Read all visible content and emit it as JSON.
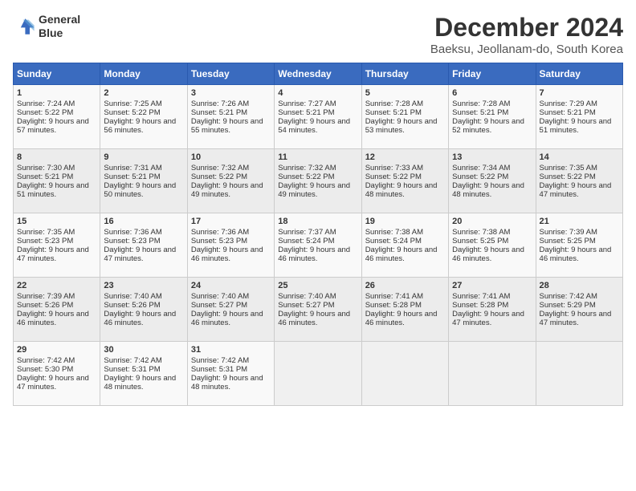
{
  "logo": {
    "line1": "General",
    "line2": "Blue"
  },
  "title": "December 2024",
  "subtitle": "Baeksu, Jeollanam-do, South Korea",
  "days_of_week": [
    "Sunday",
    "Monday",
    "Tuesday",
    "Wednesday",
    "Thursday",
    "Friday",
    "Saturday"
  ],
  "weeks": [
    [
      {
        "day": "1",
        "sunrise": "Sunrise: 7:24 AM",
        "sunset": "Sunset: 5:22 PM",
        "daylight": "Daylight: 9 hours and 57 minutes."
      },
      {
        "day": "2",
        "sunrise": "Sunrise: 7:25 AM",
        "sunset": "Sunset: 5:22 PM",
        "daylight": "Daylight: 9 hours and 56 minutes."
      },
      {
        "day": "3",
        "sunrise": "Sunrise: 7:26 AM",
        "sunset": "Sunset: 5:21 PM",
        "daylight": "Daylight: 9 hours and 55 minutes."
      },
      {
        "day": "4",
        "sunrise": "Sunrise: 7:27 AM",
        "sunset": "Sunset: 5:21 PM",
        "daylight": "Daylight: 9 hours and 54 minutes."
      },
      {
        "day": "5",
        "sunrise": "Sunrise: 7:28 AM",
        "sunset": "Sunset: 5:21 PM",
        "daylight": "Daylight: 9 hours and 53 minutes."
      },
      {
        "day": "6",
        "sunrise": "Sunrise: 7:28 AM",
        "sunset": "Sunset: 5:21 PM",
        "daylight": "Daylight: 9 hours and 52 minutes."
      },
      {
        "day": "7",
        "sunrise": "Sunrise: 7:29 AM",
        "sunset": "Sunset: 5:21 PM",
        "daylight": "Daylight: 9 hours and 51 minutes."
      }
    ],
    [
      {
        "day": "8",
        "sunrise": "Sunrise: 7:30 AM",
        "sunset": "Sunset: 5:21 PM",
        "daylight": "Daylight: 9 hours and 51 minutes."
      },
      {
        "day": "9",
        "sunrise": "Sunrise: 7:31 AM",
        "sunset": "Sunset: 5:21 PM",
        "daylight": "Daylight: 9 hours and 50 minutes."
      },
      {
        "day": "10",
        "sunrise": "Sunrise: 7:32 AM",
        "sunset": "Sunset: 5:22 PM",
        "daylight": "Daylight: 9 hours and 49 minutes."
      },
      {
        "day": "11",
        "sunrise": "Sunrise: 7:32 AM",
        "sunset": "Sunset: 5:22 PM",
        "daylight": "Daylight: 9 hours and 49 minutes."
      },
      {
        "day": "12",
        "sunrise": "Sunrise: 7:33 AM",
        "sunset": "Sunset: 5:22 PM",
        "daylight": "Daylight: 9 hours and 48 minutes."
      },
      {
        "day": "13",
        "sunrise": "Sunrise: 7:34 AM",
        "sunset": "Sunset: 5:22 PM",
        "daylight": "Daylight: 9 hours and 48 minutes."
      },
      {
        "day": "14",
        "sunrise": "Sunrise: 7:35 AM",
        "sunset": "Sunset: 5:22 PM",
        "daylight": "Daylight: 9 hours and 47 minutes."
      }
    ],
    [
      {
        "day": "15",
        "sunrise": "Sunrise: 7:35 AM",
        "sunset": "Sunset: 5:23 PM",
        "daylight": "Daylight: 9 hours and 47 minutes."
      },
      {
        "day": "16",
        "sunrise": "Sunrise: 7:36 AM",
        "sunset": "Sunset: 5:23 PM",
        "daylight": "Daylight: 9 hours and 47 minutes."
      },
      {
        "day": "17",
        "sunrise": "Sunrise: 7:36 AM",
        "sunset": "Sunset: 5:23 PM",
        "daylight": "Daylight: 9 hours and 46 minutes."
      },
      {
        "day": "18",
        "sunrise": "Sunrise: 7:37 AM",
        "sunset": "Sunset: 5:24 PM",
        "daylight": "Daylight: 9 hours and 46 minutes."
      },
      {
        "day": "19",
        "sunrise": "Sunrise: 7:38 AM",
        "sunset": "Sunset: 5:24 PM",
        "daylight": "Daylight: 9 hours and 46 minutes."
      },
      {
        "day": "20",
        "sunrise": "Sunrise: 7:38 AM",
        "sunset": "Sunset: 5:25 PM",
        "daylight": "Daylight: 9 hours and 46 minutes."
      },
      {
        "day": "21",
        "sunrise": "Sunrise: 7:39 AM",
        "sunset": "Sunset: 5:25 PM",
        "daylight": "Daylight: 9 hours and 46 minutes."
      }
    ],
    [
      {
        "day": "22",
        "sunrise": "Sunrise: 7:39 AM",
        "sunset": "Sunset: 5:26 PM",
        "daylight": "Daylight: 9 hours and 46 minutes."
      },
      {
        "day": "23",
        "sunrise": "Sunrise: 7:40 AM",
        "sunset": "Sunset: 5:26 PM",
        "daylight": "Daylight: 9 hours and 46 minutes."
      },
      {
        "day": "24",
        "sunrise": "Sunrise: 7:40 AM",
        "sunset": "Sunset: 5:27 PM",
        "daylight": "Daylight: 9 hours and 46 minutes."
      },
      {
        "day": "25",
        "sunrise": "Sunrise: 7:40 AM",
        "sunset": "Sunset: 5:27 PM",
        "daylight": "Daylight: 9 hours and 46 minutes."
      },
      {
        "day": "26",
        "sunrise": "Sunrise: 7:41 AM",
        "sunset": "Sunset: 5:28 PM",
        "daylight": "Daylight: 9 hours and 46 minutes."
      },
      {
        "day": "27",
        "sunrise": "Sunrise: 7:41 AM",
        "sunset": "Sunset: 5:28 PM",
        "daylight": "Daylight: 9 hours and 47 minutes."
      },
      {
        "day": "28",
        "sunrise": "Sunrise: 7:42 AM",
        "sunset": "Sunset: 5:29 PM",
        "daylight": "Daylight: 9 hours and 47 minutes."
      }
    ],
    [
      {
        "day": "29",
        "sunrise": "Sunrise: 7:42 AM",
        "sunset": "Sunset: 5:30 PM",
        "daylight": "Daylight: 9 hours and 47 minutes."
      },
      {
        "day": "30",
        "sunrise": "Sunrise: 7:42 AM",
        "sunset": "Sunset: 5:31 PM",
        "daylight": "Daylight: 9 hours and 48 minutes."
      },
      {
        "day": "31",
        "sunrise": "Sunrise: 7:42 AM",
        "sunset": "Sunset: 5:31 PM",
        "daylight": "Daylight: 9 hours and 48 minutes."
      },
      null,
      null,
      null,
      null
    ]
  ]
}
